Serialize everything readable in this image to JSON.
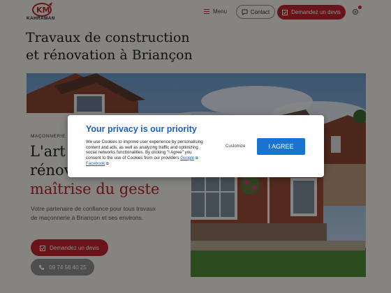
{
  "header": {
    "logo_text": "KAHRAMAN",
    "menu_label": "Menu",
    "contact_label": "Contact",
    "devis_label": "Demandez un devis"
  },
  "page": {
    "title_line1": "Travaux de construction",
    "title_line2": "et rénovation à Briançon"
  },
  "hero": {
    "kicker": "MAÇONNERIE É",
    "heading_line1": "L'art",
    "heading_line2": "rénov",
    "heading_line3": "maîtrise du geste",
    "description": "Votre partenaire de confiance pour tous travaux de maçonnerie à Briançon et ses environs.",
    "devis_button": "Demandez un devis",
    "phone_button": "09 74 56 40 25"
  },
  "cookie_modal": {
    "title": "Your privacy is our priority",
    "body": "We use Cookies to improve user experience by personalising content and ads, as well as analyzing traffic and optimizing social networks functionalities. By clicking \"I Agree\" you consent to the use of Cookies from our providers",
    "link_google": "Google",
    "link_separator": " ",
    "link_facebook": "Facebook",
    "customize_label": "Customize",
    "agree_label": "I AGREE"
  },
  "colors": {
    "brand_red": "#c0262c",
    "modal_blue": "#1d5fbd",
    "agree_blue": "#1a73cf"
  }
}
